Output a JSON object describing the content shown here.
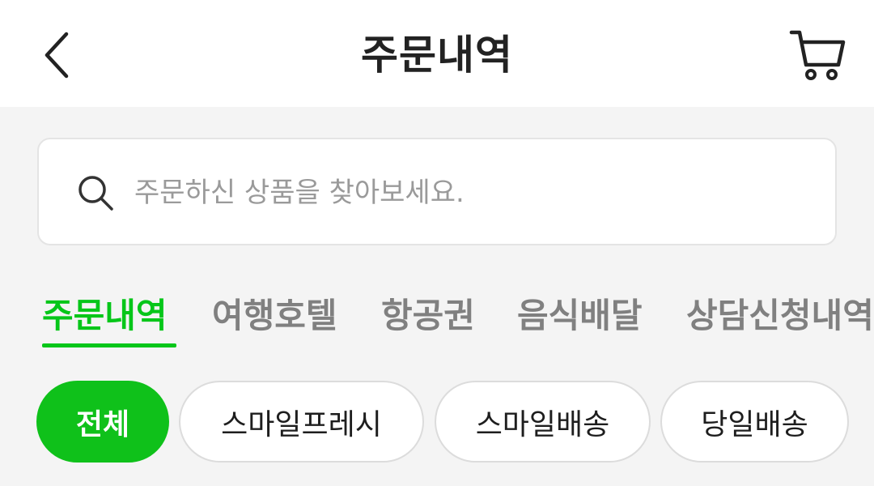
{
  "header": {
    "title": "주문내역",
    "back_icon": "chevron-left-icon",
    "cart_icon": "cart-icon"
  },
  "search": {
    "placeholder": "주문하신 상품을 찾아보세요.",
    "value": "",
    "icon": "search-icon"
  },
  "tabs": [
    {
      "label": "주문내역",
      "active": true
    },
    {
      "label": "여행호텔",
      "active": false
    },
    {
      "label": "항공권",
      "active": false
    },
    {
      "label": "음식배달",
      "active": false
    },
    {
      "label": "상담신청내역",
      "active": false
    }
  ],
  "filters": [
    {
      "label": "전체",
      "active": true
    },
    {
      "label": "스마일프레시",
      "active": false
    },
    {
      "label": "스마일배송",
      "active": false
    },
    {
      "label": "당일배송",
      "active": false
    }
  ],
  "colors": {
    "accent": "#06c619",
    "chip_active": "#0fc11a",
    "background": "#f4f4f4",
    "tab_inactive": "#808080"
  }
}
